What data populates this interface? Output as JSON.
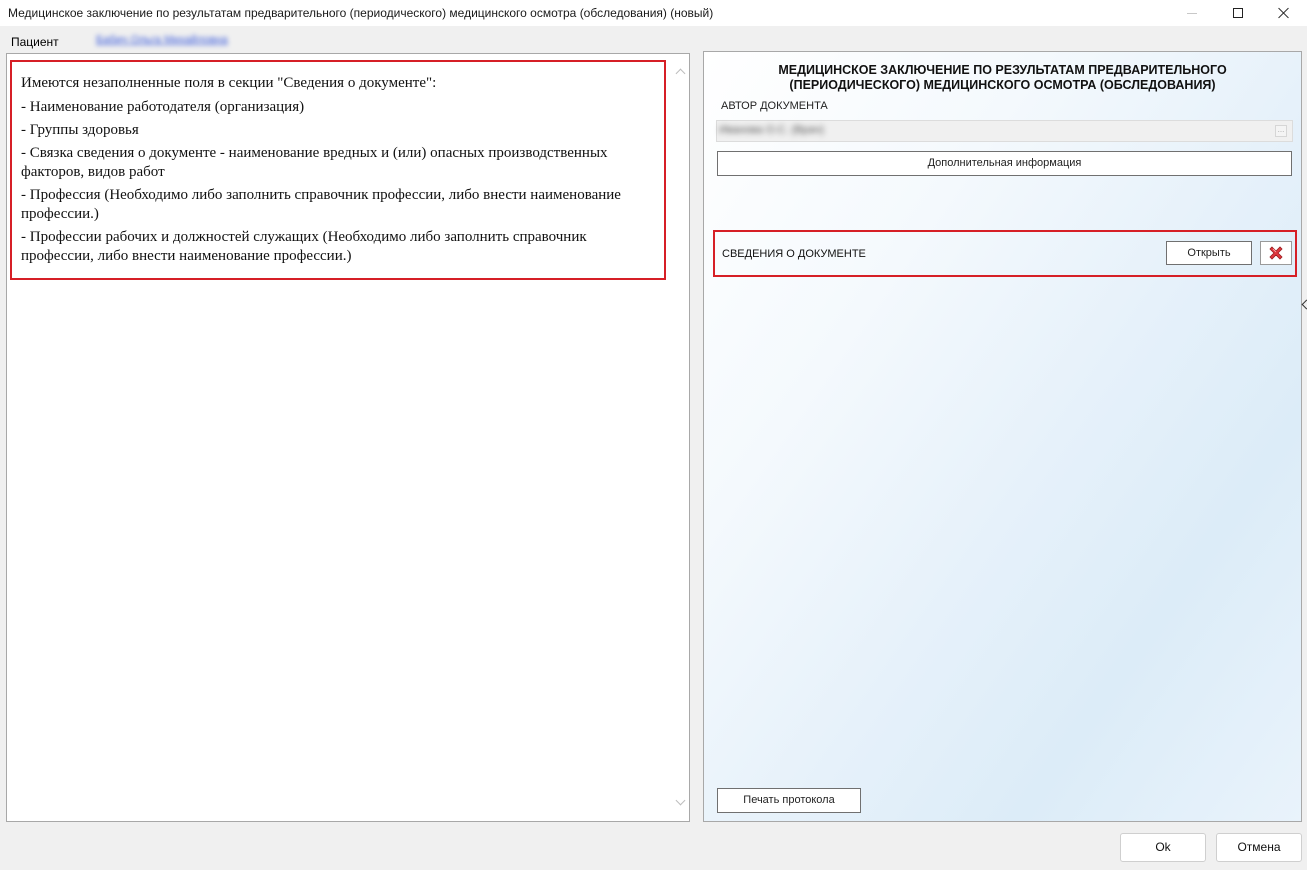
{
  "window": {
    "title": "Медицинское заключение по результатам предварительного (периодического) медицинского осмотра (обследования) (новый)"
  },
  "patient": {
    "label": "Пациент",
    "name": "Бабич Ольга Михайловна"
  },
  "validation": {
    "lines": [
      "Имеются незаполненные поля в секции \"Сведения о документе\":",
      "- Наименование работодателя (организация)",
      "- Группы здоровья",
      "- Связка сведения о документе - наименование вредных и (или) опасных производственных факторов, видов работ",
      "- Профессия (Необходимо либо заполнить справочник профессии, либо внести наименование профессии.)",
      "- Профессии рабочих и должностей служащих (Необходимо либо заполнить справочник профессии, либо внести наименование профессии.)"
    ]
  },
  "document": {
    "title_line1": "МЕДИЦИНСКОЕ ЗАКЛЮЧЕНИЕ ПО РЕЗУЛЬТАТАМ ПРЕДВАРИТЕЛЬНОГО",
    "title_line2": "(ПЕРИОДИЧЕСКОГО) МЕДИЦИНСКОГО ОСМОТРА (ОБСЛЕДОВАНИЯ)",
    "author_label": "АВТОР ДОКУМЕНТА",
    "author_value": "Иванова О.С. (Врач)",
    "browse_label": "...",
    "additional_info_button": "Дополнительная информация",
    "section_label": "СВЕДЕНИЯ О ДОКУМЕНТЕ",
    "open_button": "Открыть",
    "print_button": "Печать протокола"
  },
  "footer": {
    "ok_button": "Ok",
    "cancel_button": "Отмена"
  },
  "colors": {
    "highlight_border": "#d61f26",
    "link": "#3b5bdb"
  }
}
